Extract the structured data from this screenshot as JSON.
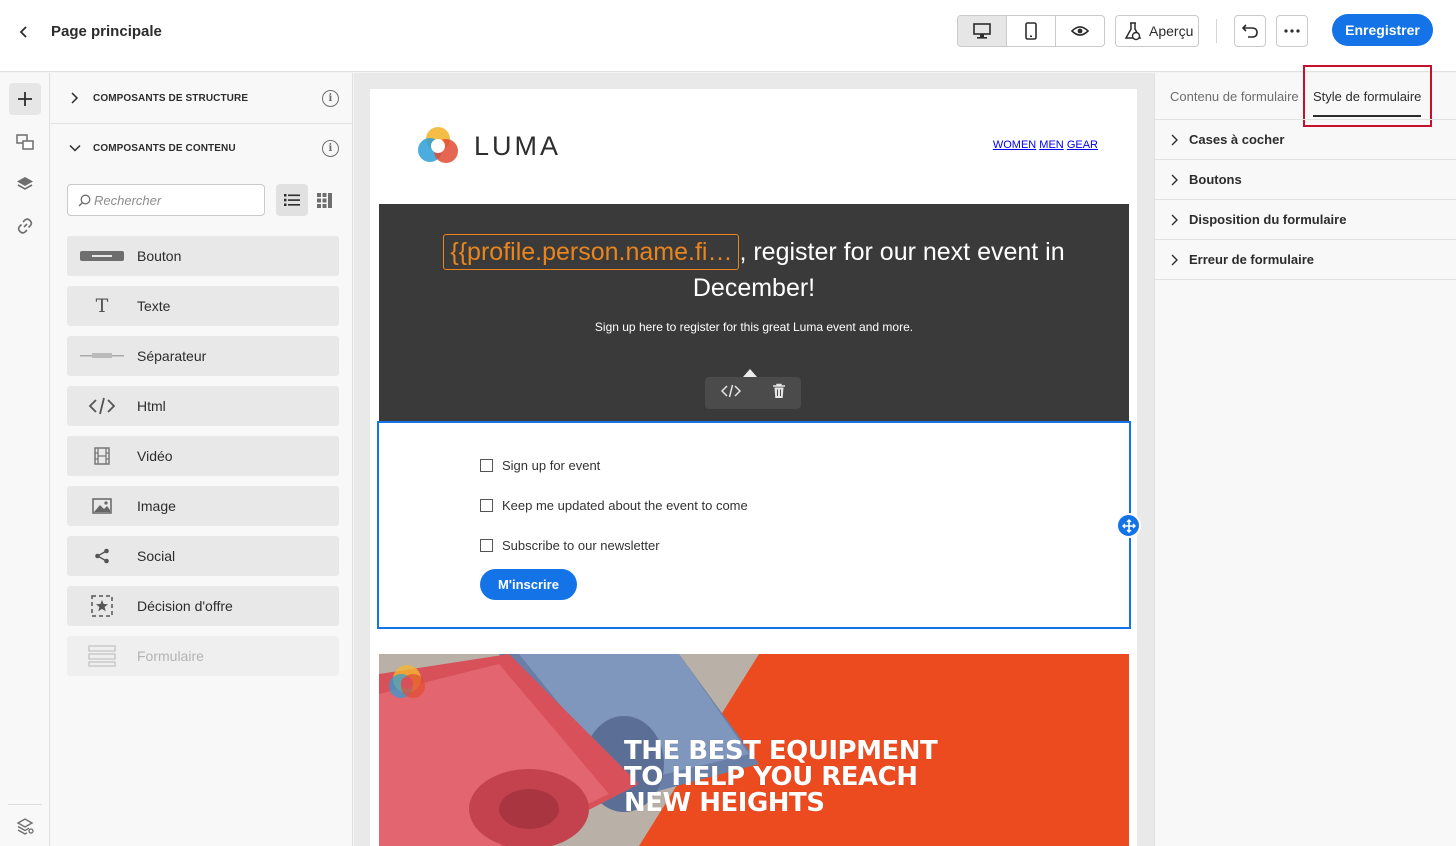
{
  "topbar": {
    "title": "Page principale",
    "apercu_label": "Aperçu",
    "save_label": "Enregistrer"
  },
  "components": {
    "structure_header": "COMPOSANTS DE STRUCTURE",
    "content_header": "COMPOSANTS DE CONTENU",
    "search_placeholder": "Rechercher",
    "items": [
      {
        "label": "Bouton",
        "icon": "button-icon"
      },
      {
        "label": "Texte",
        "icon": "text-icon"
      },
      {
        "label": "Séparateur",
        "icon": "divider-icon"
      },
      {
        "label": "Html",
        "icon": "code-icon"
      },
      {
        "label": "Vidéo",
        "icon": "video-icon"
      },
      {
        "label": "Image",
        "icon": "image-icon"
      },
      {
        "label": "Social",
        "icon": "share-icon"
      },
      {
        "label": "Décision d'offre",
        "icon": "offer-decision-icon"
      },
      {
        "label": "Formulaire",
        "icon": "form-icon",
        "disabled": true
      }
    ]
  },
  "email": {
    "brand": "LUMA",
    "nav": [
      "WOMEN",
      "MEN",
      "GEAR"
    ],
    "hero": {
      "token": "{{profile.person.name.fi…",
      "title_rest": ", register for our next event in December!",
      "subtitle": "Sign up here to register for this great Luma event and more."
    },
    "form": {
      "checkboxes": [
        "Sign up for event",
        "Keep me updated about the event to come",
        "Subscribe to our newsletter"
      ],
      "button_label": "M'inscrire"
    },
    "banner": {
      "lines": [
        "THE BEST EQUIPMENT",
        "TO HELP YOU REACH",
        "NEW HEIGHTS"
      ]
    }
  },
  "right_panel": {
    "tabs": [
      "Contenu de formulaire",
      "Style de formulaire"
    ],
    "active_tab": "Style de formulaire",
    "sections": [
      "Cases à cocher",
      "Boutons",
      "Disposition du formulaire",
      "Erreur de formulaire"
    ]
  },
  "colors": {
    "accent": "#1473e6",
    "highlight": "#c8102e",
    "token": "#e8851e",
    "hero_bg": "#3a3a3a",
    "banner": "#e8592c"
  }
}
